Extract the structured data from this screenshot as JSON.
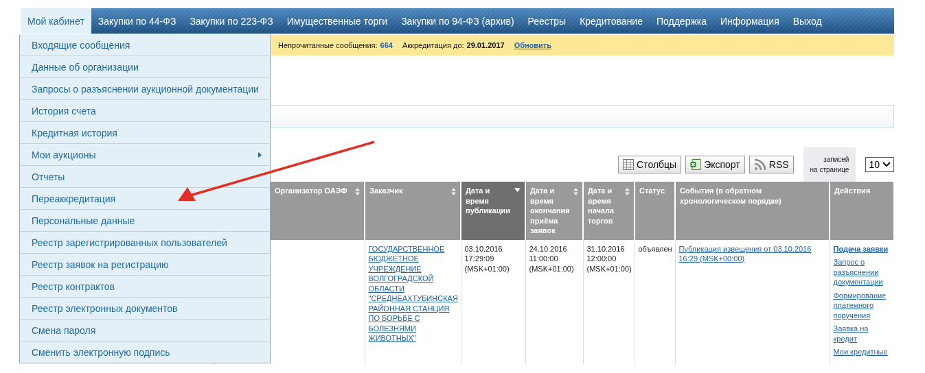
{
  "nav": {
    "tabs": [
      {
        "label": "Мой кабинет",
        "selected": true
      },
      {
        "label": "Закупки по 44-ФЗ",
        "selected": false
      },
      {
        "label": "Закупки по 223-ФЗ",
        "selected": false
      },
      {
        "label": "Имущественные торги",
        "selected": false
      },
      {
        "label": "Закупки по 94-ФЗ (архив)",
        "selected": false
      },
      {
        "label": "Реестры",
        "selected": false
      },
      {
        "label": "Кредитование",
        "selected": false
      },
      {
        "label": "Поддержка",
        "selected": false
      },
      {
        "label": "Информация",
        "selected": false
      },
      {
        "label": "Выход",
        "selected": false
      }
    ]
  },
  "dropdown": {
    "items": [
      {
        "label": "Входящие сообщения",
        "has_submenu": false
      },
      {
        "label": "Данные об организации",
        "has_submenu": false
      },
      {
        "label": "Запросы о разъяснении аукционной документации",
        "has_submenu": false
      },
      {
        "label": "История счета",
        "has_submenu": false
      },
      {
        "label": "Кредитная история",
        "has_submenu": false
      },
      {
        "label": "Мои аукционы",
        "has_submenu": true
      },
      {
        "label": "Отчеты",
        "has_submenu": false
      },
      {
        "label": "Переаккредитация",
        "has_submenu": false
      },
      {
        "label": "Персональные данные",
        "has_submenu": false
      },
      {
        "label": "Реестр зарегистрированных пользователей",
        "has_submenu": false
      },
      {
        "label": "Реестр заявок на регистрацию",
        "has_submenu": false
      },
      {
        "label": "Реестр контрактов",
        "has_submenu": false
      },
      {
        "label": "Реестр электронных документов",
        "has_submenu": false
      },
      {
        "label": "Смена пароля",
        "has_submenu": false
      },
      {
        "label": "Сменить электронную подпись",
        "has_submenu": false
      }
    ]
  },
  "info_bar": {
    "unread_label": "Непрочитанные сообщения:",
    "unread_count": "664",
    "accreditation_label": "Аккредитация до:",
    "accreditation_date": "29.01.2017",
    "refresh_link": "Обновить"
  },
  "toolbar": {
    "buttons": [
      {
        "kind": "columns",
        "label": "Столбцы"
      },
      {
        "kind": "export",
        "label": "Экспорт"
      },
      {
        "kind": "rss",
        "label": "RSS"
      }
    ],
    "per_page_label": "записей\nна странице",
    "per_page_value": "10"
  },
  "table": {
    "columns": [
      {
        "label": "Организатор ОАЭФ",
        "sorted": false
      },
      {
        "label": "Заказчик",
        "sorted": false
      },
      {
        "label": "Дата и время публикации",
        "sorted": true
      },
      {
        "label": "Дата и время окончания приёма заявок",
        "sorted": false
      },
      {
        "label": "Дата и время начала торгов",
        "sorted": false
      },
      {
        "label": "Статус"
      },
      {
        "label": "События (в обратном хронологическом порядке)"
      },
      {
        "label": "Действия"
      }
    ],
    "rows": [
      {
        "customer": "ГОСУДАРСТВЕННОЕ БЮДЖЕТНОЕ УЧРЕЖДЕНИЕ ВОЛГОГРАДСКОЙ ОБЛАСТИ \"СРЕДНЕАХТУБИНСКАЯ РАЙОННАЯ СТАНЦИЯ ПО БОРЬБЕ С БОЛЕЗНЯМИ ЖИВОТНЫХ\"",
        "published": "03.10.2016\n17:29:09\n(MSK+01:00)",
        "apps_end": "24.10.2016\n11:00:00\n(MSK+01:00)",
        "trading_start": "31.10.2016\n12:00:00\n(MSK+01:00)",
        "status": "объявлен",
        "event": "Публикация извещения от 03.10.2016 16:29 (MSK+00:00)",
        "actions": [
          {
            "label": "Подача заявки",
            "primary": true
          },
          {
            "label": "Запрос о разъяснении документации",
            "primary": false
          },
          {
            "label": "Формирование платежного поручения",
            "primary": false
          },
          {
            "label": "Заявка на кредит",
            "primary": false
          },
          {
            "label": "Мои кредитные",
            "primary": false
          }
        ]
      }
    ]
  }
}
